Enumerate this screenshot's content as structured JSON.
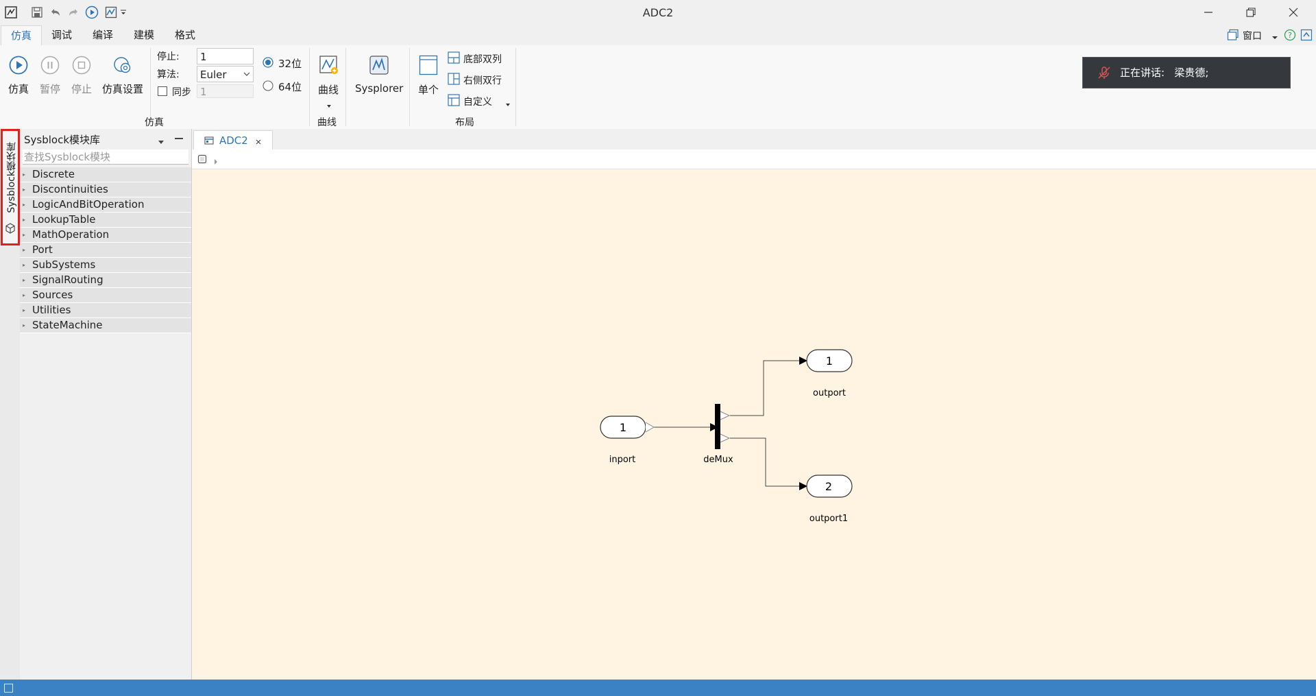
{
  "window": {
    "title": "ADC2"
  },
  "menu": {
    "tabs": [
      "仿真",
      "调试",
      "编译",
      "建模",
      "格式"
    ],
    "active": "仿真",
    "window_label": "窗口"
  },
  "ribbon": {
    "sim_buttons": [
      "仿真",
      "暂停",
      "停止",
      "仿真设置"
    ],
    "stop_label": "停止:",
    "stop_value": "1",
    "algo_label": "算法:",
    "algo_value": "Euler",
    "sync_label": "同步",
    "sync_value": "1",
    "bit32": "32位",
    "bit64": "64位",
    "curve_label": "曲线",
    "sysplorer_label": "Sysplorer",
    "single_label": "单个",
    "layout_items": [
      "底部双列",
      "右侧双行",
      "自定义"
    ],
    "group_sim": "仿真",
    "group_curve": "曲线",
    "group_layout": "布局"
  },
  "notification": {
    "text": "正在讲话:   梁贵德;"
  },
  "sidebar": {
    "vertical_tab": "Sysblock模块库",
    "title": "Sysblock模块库",
    "search_placeholder": "查找Sysblock模块",
    "items": [
      "Discrete",
      "Discontinuities",
      "LogicAndBitOperation",
      "LookupTable",
      "MathOperation",
      "Port",
      "SubSystems",
      "SignalRouting",
      "Sources",
      "Utilities",
      "StateMachine"
    ]
  },
  "document": {
    "tab_label": "ADC2"
  },
  "diagram": {
    "inport": {
      "number": "1",
      "label": "inport"
    },
    "demux": {
      "label": "deMux"
    },
    "outport": {
      "number": "1",
      "label": "outport"
    },
    "outport1": {
      "number": "2",
      "label": "outport1"
    }
  },
  "colors": {
    "accent": "#2e75b6",
    "canvas_bg": "#fff3e1",
    "status_bar": "#3b82c4",
    "highlight": "#e01f1f"
  }
}
